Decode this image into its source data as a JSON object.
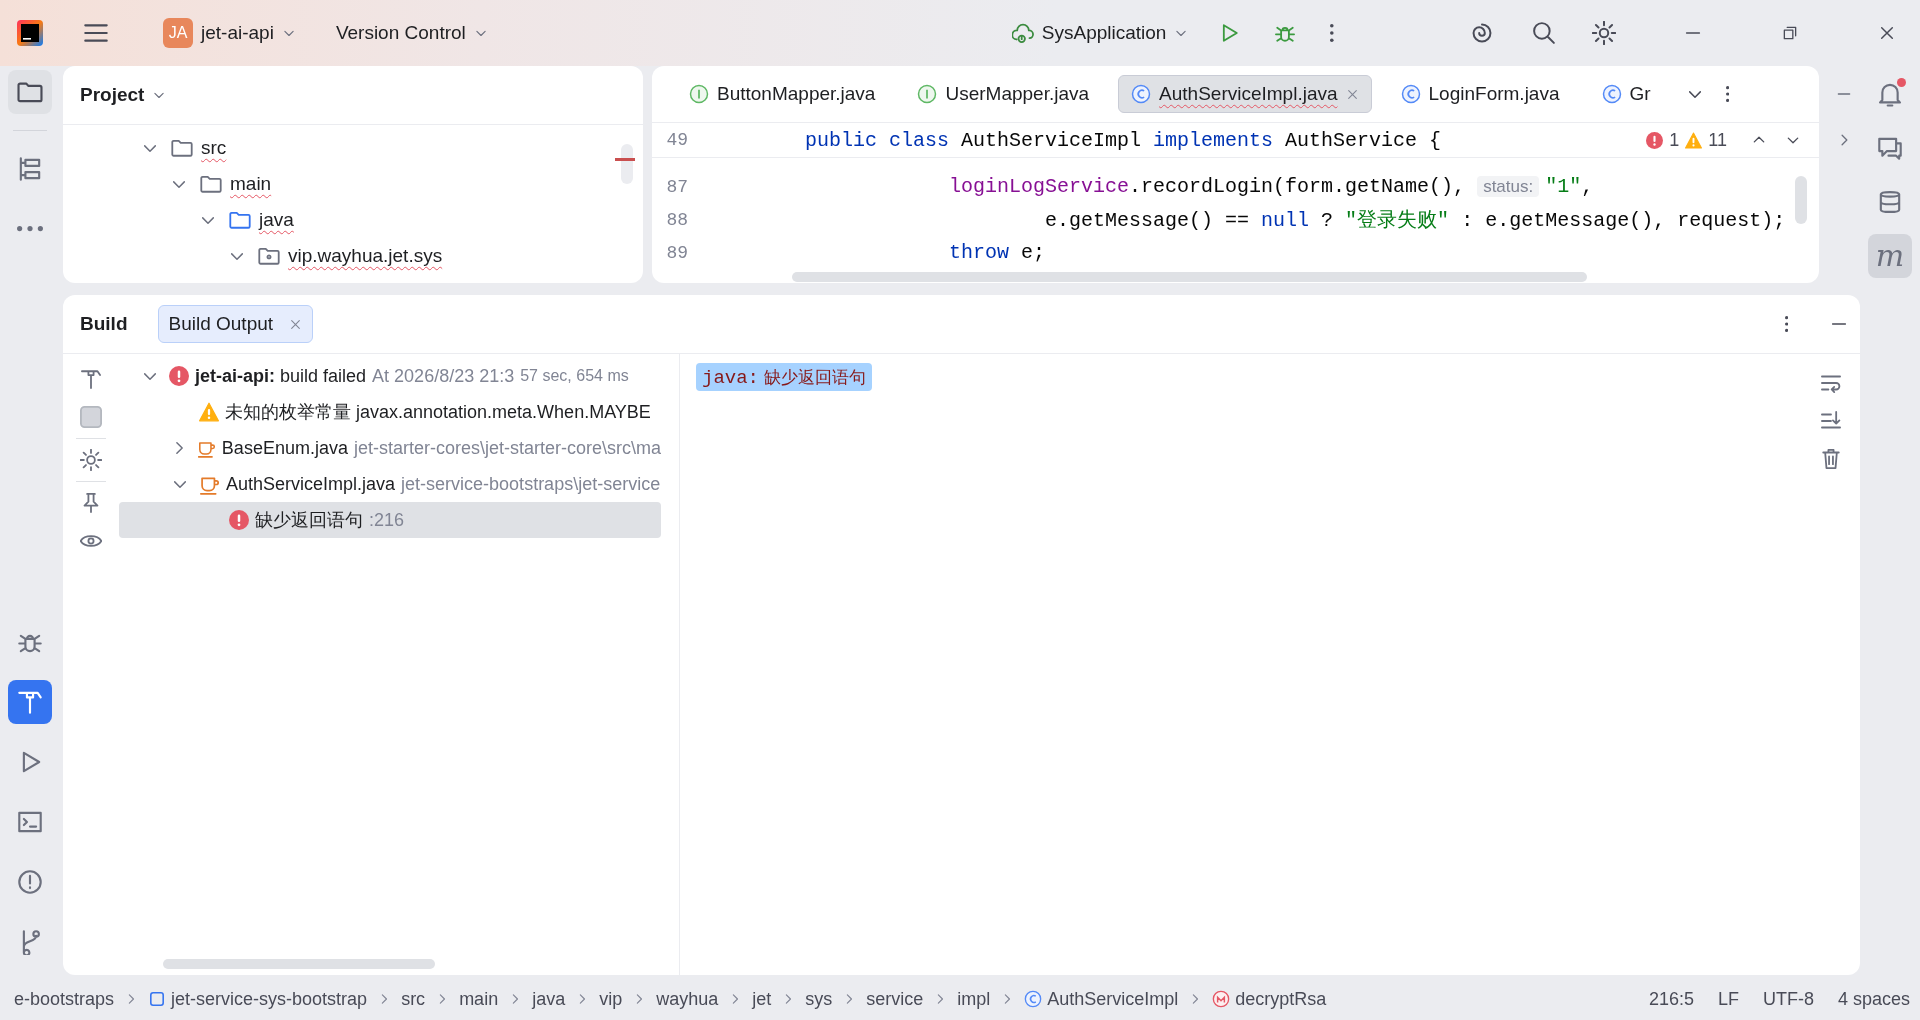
{
  "title_bar": {
    "project": {
      "badge": "JA",
      "name": "jet-ai-api"
    },
    "vcs": "Version Control",
    "run_config": "SysApplication"
  },
  "left_toolbar": {
    "top": [
      {
        "selected": true
      },
      {
        "selected": false
      },
      {
        "selected": false
      }
    ],
    "bottom": [
      {
        "selected": false
      },
      {
        "selected": true
      },
      {
        "selected": false
      },
      {
        "selected": false
      },
      {
        "selected": false
      },
      {
        "selected": false
      }
    ]
  },
  "project_panel": {
    "title": "Project",
    "tree": [
      {
        "label": "src",
        "kind": "folder",
        "expanded": true,
        "children": [
          {
            "label": "main",
            "kind": "folder",
            "expanded": true,
            "children": [
              {
                "label": "java",
                "kind": "source",
                "expanded": true,
                "children": [
                  {
                    "label": "vip.wayhua.jet.sys",
                    "kind": "package",
                    "expanded": true
                  }
                ]
              }
            ]
          }
        ]
      }
    ]
  },
  "editor": {
    "tabs": [
      {
        "label": "ButtonMapper.java",
        "kind": "interface",
        "selected": false
      },
      {
        "label": "UserMapper.java",
        "kind": "interface",
        "selected": false
      },
      {
        "label": "AuthServiceImpl.java",
        "kind": "class",
        "selected": true
      },
      {
        "label": "LoginForm.java",
        "kind": "class",
        "selected": false
      },
      {
        "label": "Gr",
        "kind": "class",
        "selected": false
      }
    ],
    "sticky_line": {
      "number": "49",
      "tokens": [
        {
          "kind": "keyword",
          "text": "public class "
        },
        {
          "kind": "plain",
          "text": "AuthServiceImpl "
        },
        {
          "kind": "keyword",
          "text": "implements "
        },
        {
          "kind": "plain",
          "text": "AuthService {"
        }
      ]
    },
    "inspections": {
      "errors": "1",
      "warnings": "11"
    },
    "lines": [
      {
        "number": "87",
        "tokens": [
          {
            "kind": "field",
            "text": "            loginLogService"
          },
          {
            "kind": "plain",
            "text": ".recordLogin(form.getName(), "
          },
          {
            "kind": "hint",
            "text": "status:"
          },
          {
            "kind": "string",
            "text": "\"1\""
          },
          {
            "kind": "plain",
            "text": ","
          }
        ]
      },
      {
        "number": "88",
        "tokens": [
          {
            "kind": "plain",
            "text": "                    e.getMessage() == "
          },
          {
            "kind": "keyword",
            "text": "null"
          },
          {
            "kind": "plain",
            "text": " ? "
          },
          {
            "kind": "string",
            "text": "\"登录失败\""
          },
          {
            "kind": "plain",
            "text": " : e.getMessage(), request);"
          }
        ]
      },
      {
        "number": "89",
        "tokens": [
          {
            "kind": "keyword",
            "text": "            throw"
          },
          {
            "kind": "plain",
            "text": " e;"
          }
        ]
      }
    ]
  },
  "right_toolbar": [
    {
      "kind": "icon",
      "selected": false,
      "badge": true
    },
    {
      "kind": "icon",
      "selected": false,
      "badge": false
    },
    {
      "kind": "icon",
      "selected": false,
      "badge": false
    },
    {
      "kind": "letter",
      "text": "m",
      "selected": true,
      "badge": false
    }
  ],
  "build": {
    "title": "Build",
    "tabs": [
      {
        "label": "Build Output",
        "selected": true
      }
    ],
    "tree": [
      {
        "kind": "failed",
        "expanded": true,
        "selected": false,
        "name": "jet-ai-api:",
        "text": "build failed",
        "detail": "At 2026/8/23 21:3",
        "duration": "57 sec, 654 ms",
        "children": [
          {
            "kind": "warning",
            "selected": false,
            "text": "未知的枚举常量 javax.annotation.meta.When.MAYBE"
          },
          {
            "kind": "file",
            "expanded": false,
            "selected": false,
            "name": "BaseEnum.java",
            "detail": "jet-starter-cores\\jet-starter-core\\src\\ma"
          },
          {
            "kind": "file",
            "expanded": true,
            "selected": false,
            "name": "AuthServiceImpl.java",
            "detail": "jet-service-bootstraps\\jet-service",
            "children": [
              {
                "kind": "error",
                "selected": true,
                "text": "缺少返回语句",
                "detail": ":216"
              }
            ]
          }
        ]
      }
    ],
    "output": {
      "label": "java:",
      "text": "缺少返回语句",
      "selected": true
    }
  },
  "status_bar": {
    "breadcrumbs": [
      {
        "label": "e-bootstraps",
        "kind": "plain"
      },
      {
        "label": "jet-service-sys-bootstrap",
        "kind": "module"
      },
      {
        "label": "src",
        "kind": "plain"
      },
      {
        "label": "main",
        "kind": "plain"
      },
      {
        "label": "java",
        "kind": "plain"
      },
      {
        "label": "vip",
        "kind": "plain"
      },
      {
        "label": "wayhua",
        "kind": "plain"
      },
      {
        "label": "jet",
        "kind": "plain"
      },
      {
        "label": "sys",
        "kind": "plain"
      },
      {
        "label": "service",
        "kind": "plain"
      },
      {
        "label": "impl",
        "kind": "plain"
      },
      {
        "label": "AuthServiceImpl",
        "kind": "class"
      },
      {
        "label": "decryptRsa",
        "kind": "method"
      }
    ],
    "position": "216:5",
    "line_separator": "LF",
    "encoding": "UTF-8",
    "indent": "4 spaces"
  }
}
